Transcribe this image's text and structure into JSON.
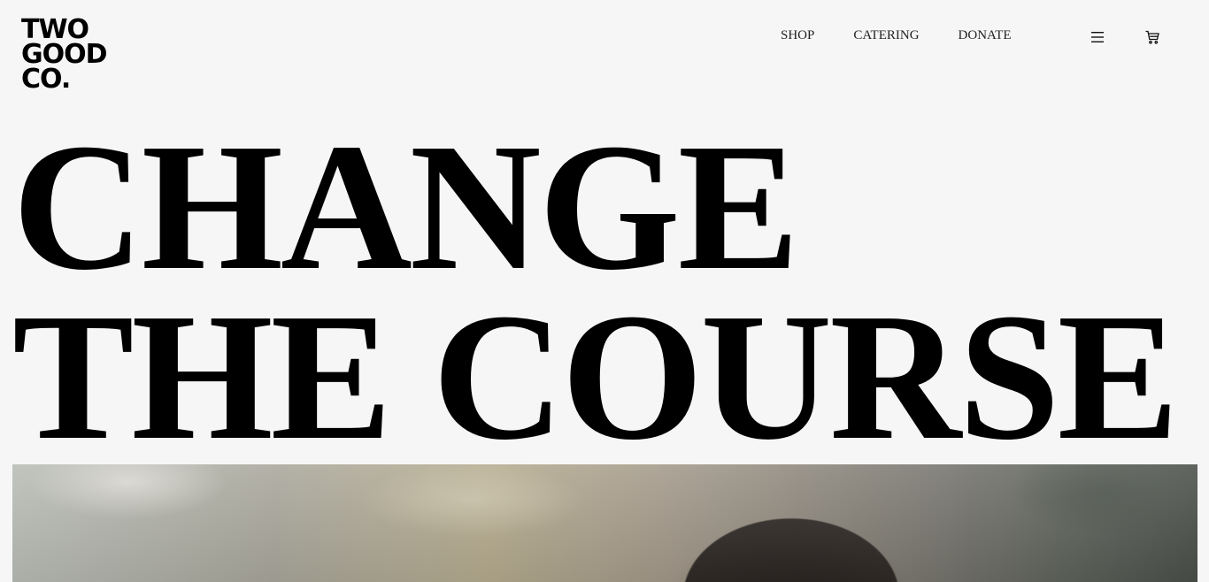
{
  "brand": {
    "logo_lines": [
      "TWO",
      "GOOD",
      "CO."
    ]
  },
  "nav": {
    "links": [
      "SHOP",
      "CATERING",
      "DONATE"
    ],
    "menu_icon": "hamburger-menu-icon",
    "cart_icon": "shopping-cart-icon"
  },
  "hero": {
    "headline_lines": [
      "CHANGE",
      "THE COURSE"
    ]
  },
  "colors": {
    "background": "#f6f6f6",
    "text": "#000000"
  }
}
